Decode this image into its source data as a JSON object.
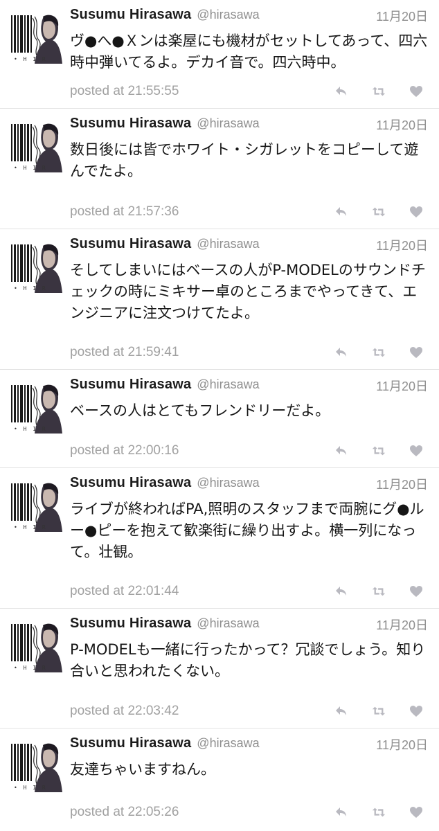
{
  "colors": {
    "accent": "#1b1b1b",
    "muted": "#8f8f8f",
    "icon": "#b9b9c0",
    "divider": "#e3e3e3"
  },
  "icons": {
    "reply": "reply-icon",
    "retweet": "retweet-icon",
    "favorite": "heart-icon"
  },
  "tweets": [
    {
      "name": "Susumu Hirasawa",
      "handle": "@hirasawa",
      "date": "11月20日",
      "text": "ヴ●へ●Ｘンは楽屋にも機材がセットしてあって、四六時中弾いてるよ。デカイ音で。四六時中。",
      "posted": "posted at 21:55:55"
    },
    {
      "name": "Susumu Hirasawa",
      "handle": "@hirasawa",
      "date": "11月20日",
      "text": "数日後には皆でホワイト・シガレットをコピーして遊んでたよ。",
      "posted": "posted at 21:57:36"
    },
    {
      "name": "Susumu Hirasawa",
      "handle": "@hirasawa",
      "date": "11月20日",
      "text": "そしてしまいにはベースの人がP-MODELのサウンドチェックの時にミキサー卓のところまでやってきて、エンジニアに注文つけてたよ。",
      "posted": "posted at 21:59:41"
    },
    {
      "name": "Susumu Hirasawa",
      "handle": "@hirasawa",
      "date": "11月20日",
      "text": "ベースの人はとてもフレンドリーだよ。",
      "posted": "posted at 22:00:16"
    },
    {
      "name": "Susumu Hirasawa",
      "handle": "@hirasawa",
      "date": "11月20日",
      "text": "ライブが終わればPA,照明のスタッフまで両腕にグ●ルー●ピーを抱えて歓楽街に繰り出すよ。横一列になって。壮観。",
      "posted": "posted at 22:01:44"
    },
    {
      "name": "Susumu Hirasawa",
      "handle": "@hirasawa",
      "date": "11月20日",
      "text": "P-MODELも一緒に行ったかって？冗談でしょう。知り合いと思われたくない。",
      "posted": "posted at 22:03:42"
    },
    {
      "name": "Susumu Hirasawa",
      "handle": "@hirasawa",
      "date": "11月20日",
      "text": "友達ちゃいますねん。",
      "posted": "posted at 22:05:26"
    }
  ]
}
